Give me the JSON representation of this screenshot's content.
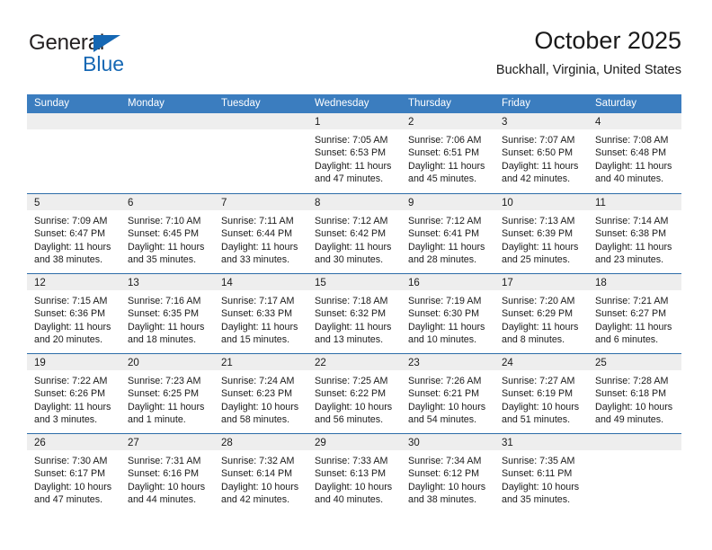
{
  "brand": {
    "name_part1": "General",
    "name_part2": "Blue",
    "logo_icon": "triangle-logo-icon",
    "colors": {
      "accent": "#1668b4",
      "dark": "#231f20"
    }
  },
  "header": {
    "title": "October 2025",
    "subtitle": "Buckhall, Virginia, United States"
  },
  "calendar": {
    "colors": {
      "header_bg": "#3b7dbf",
      "header_text": "#ffffff",
      "row_divider": "#2e6da9",
      "day_band_bg": "#eeeeee",
      "cell_bg": "#ffffff"
    },
    "weekdays": [
      "Sunday",
      "Monday",
      "Tuesday",
      "Wednesday",
      "Thursday",
      "Friday",
      "Saturday"
    ],
    "labels": {
      "sunrise": "Sunrise:",
      "sunset": "Sunset:",
      "daylight": "Daylight:"
    },
    "weeks": [
      [
        {
          "day": "",
          "line1": "",
          "line2": "",
          "line3": "",
          "line4": "",
          "empty": true
        },
        {
          "day": "",
          "line1": "",
          "line2": "",
          "line3": "",
          "line4": "",
          "empty": true
        },
        {
          "day": "",
          "line1": "",
          "line2": "",
          "line3": "",
          "line4": "",
          "empty": true
        },
        {
          "day": "1",
          "line1": "Sunrise: 7:05 AM",
          "line2": "Sunset: 6:53 PM",
          "line3": "Daylight: 11 hours",
          "line4": "and 47 minutes.",
          "empty": false
        },
        {
          "day": "2",
          "line1": "Sunrise: 7:06 AM",
          "line2": "Sunset: 6:51 PM",
          "line3": "Daylight: 11 hours",
          "line4": "and 45 minutes.",
          "empty": false
        },
        {
          "day": "3",
          "line1": "Sunrise: 7:07 AM",
          "line2": "Sunset: 6:50 PM",
          "line3": "Daylight: 11 hours",
          "line4": "and 42 minutes.",
          "empty": false
        },
        {
          "day": "4",
          "line1": "Sunrise: 7:08 AM",
          "line2": "Sunset: 6:48 PM",
          "line3": "Daylight: 11 hours",
          "line4": "and 40 minutes.",
          "empty": false
        }
      ],
      [
        {
          "day": "5",
          "line1": "Sunrise: 7:09 AM",
          "line2": "Sunset: 6:47 PM",
          "line3": "Daylight: 11 hours",
          "line4": "and 38 minutes.",
          "empty": false
        },
        {
          "day": "6",
          "line1": "Sunrise: 7:10 AM",
          "line2": "Sunset: 6:45 PM",
          "line3": "Daylight: 11 hours",
          "line4": "and 35 minutes.",
          "empty": false
        },
        {
          "day": "7",
          "line1": "Sunrise: 7:11 AM",
          "line2": "Sunset: 6:44 PM",
          "line3": "Daylight: 11 hours",
          "line4": "and 33 minutes.",
          "empty": false
        },
        {
          "day": "8",
          "line1": "Sunrise: 7:12 AM",
          "line2": "Sunset: 6:42 PM",
          "line3": "Daylight: 11 hours",
          "line4": "and 30 minutes.",
          "empty": false
        },
        {
          "day": "9",
          "line1": "Sunrise: 7:12 AM",
          "line2": "Sunset: 6:41 PM",
          "line3": "Daylight: 11 hours",
          "line4": "and 28 minutes.",
          "empty": false
        },
        {
          "day": "10",
          "line1": "Sunrise: 7:13 AM",
          "line2": "Sunset: 6:39 PM",
          "line3": "Daylight: 11 hours",
          "line4": "and 25 minutes.",
          "empty": false
        },
        {
          "day": "11",
          "line1": "Sunrise: 7:14 AM",
          "line2": "Sunset: 6:38 PM",
          "line3": "Daylight: 11 hours",
          "line4": "and 23 minutes.",
          "empty": false
        }
      ],
      [
        {
          "day": "12",
          "line1": "Sunrise: 7:15 AM",
          "line2": "Sunset: 6:36 PM",
          "line3": "Daylight: 11 hours",
          "line4": "and 20 minutes.",
          "empty": false
        },
        {
          "day": "13",
          "line1": "Sunrise: 7:16 AM",
          "line2": "Sunset: 6:35 PM",
          "line3": "Daylight: 11 hours",
          "line4": "and 18 minutes.",
          "empty": false
        },
        {
          "day": "14",
          "line1": "Sunrise: 7:17 AM",
          "line2": "Sunset: 6:33 PM",
          "line3": "Daylight: 11 hours",
          "line4": "and 15 minutes.",
          "empty": false
        },
        {
          "day": "15",
          "line1": "Sunrise: 7:18 AM",
          "line2": "Sunset: 6:32 PM",
          "line3": "Daylight: 11 hours",
          "line4": "and 13 minutes.",
          "empty": false
        },
        {
          "day": "16",
          "line1": "Sunrise: 7:19 AM",
          "line2": "Sunset: 6:30 PM",
          "line3": "Daylight: 11 hours",
          "line4": "and 10 minutes.",
          "empty": false
        },
        {
          "day": "17",
          "line1": "Sunrise: 7:20 AM",
          "line2": "Sunset: 6:29 PM",
          "line3": "Daylight: 11 hours",
          "line4": "and 8 minutes.",
          "empty": false
        },
        {
          "day": "18",
          "line1": "Sunrise: 7:21 AM",
          "line2": "Sunset: 6:27 PM",
          "line3": "Daylight: 11 hours",
          "line4": "and 6 minutes.",
          "empty": false
        }
      ],
      [
        {
          "day": "19",
          "line1": "Sunrise: 7:22 AM",
          "line2": "Sunset: 6:26 PM",
          "line3": "Daylight: 11 hours",
          "line4": "and 3 minutes.",
          "empty": false
        },
        {
          "day": "20",
          "line1": "Sunrise: 7:23 AM",
          "line2": "Sunset: 6:25 PM",
          "line3": "Daylight: 11 hours",
          "line4": "and 1 minute.",
          "empty": false
        },
        {
          "day": "21",
          "line1": "Sunrise: 7:24 AM",
          "line2": "Sunset: 6:23 PM",
          "line3": "Daylight: 10 hours",
          "line4": "and 58 minutes.",
          "empty": false
        },
        {
          "day": "22",
          "line1": "Sunrise: 7:25 AM",
          "line2": "Sunset: 6:22 PM",
          "line3": "Daylight: 10 hours",
          "line4": "and 56 minutes.",
          "empty": false
        },
        {
          "day": "23",
          "line1": "Sunrise: 7:26 AM",
          "line2": "Sunset: 6:21 PM",
          "line3": "Daylight: 10 hours",
          "line4": "and 54 minutes.",
          "empty": false
        },
        {
          "day": "24",
          "line1": "Sunrise: 7:27 AM",
          "line2": "Sunset: 6:19 PM",
          "line3": "Daylight: 10 hours",
          "line4": "and 51 minutes.",
          "empty": false
        },
        {
          "day": "25",
          "line1": "Sunrise: 7:28 AM",
          "line2": "Sunset: 6:18 PM",
          "line3": "Daylight: 10 hours",
          "line4": "and 49 minutes.",
          "empty": false
        }
      ],
      [
        {
          "day": "26",
          "line1": "Sunrise: 7:30 AM",
          "line2": "Sunset: 6:17 PM",
          "line3": "Daylight: 10 hours",
          "line4": "and 47 minutes.",
          "empty": false
        },
        {
          "day": "27",
          "line1": "Sunrise: 7:31 AM",
          "line2": "Sunset: 6:16 PM",
          "line3": "Daylight: 10 hours",
          "line4": "and 44 minutes.",
          "empty": false
        },
        {
          "day": "28",
          "line1": "Sunrise: 7:32 AM",
          "line2": "Sunset: 6:14 PM",
          "line3": "Daylight: 10 hours",
          "line4": "and 42 minutes.",
          "empty": false
        },
        {
          "day": "29",
          "line1": "Sunrise: 7:33 AM",
          "line2": "Sunset: 6:13 PM",
          "line3": "Daylight: 10 hours",
          "line4": "and 40 minutes.",
          "empty": false
        },
        {
          "day": "30",
          "line1": "Sunrise: 7:34 AM",
          "line2": "Sunset: 6:12 PM",
          "line3": "Daylight: 10 hours",
          "line4": "and 38 minutes.",
          "empty": false
        },
        {
          "day": "31",
          "line1": "Sunrise: 7:35 AM",
          "line2": "Sunset: 6:11 PM",
          "line3": "Daylight: 10 hours",
          "line4": "and 35 minutes.",
          "empty": false
        },
        {
          "day": "",
          "line1": "",
          "line2": "",
          "line3": "",
          "line4": "",
          "empty": true
        }
      ]
    ]
  }
}
